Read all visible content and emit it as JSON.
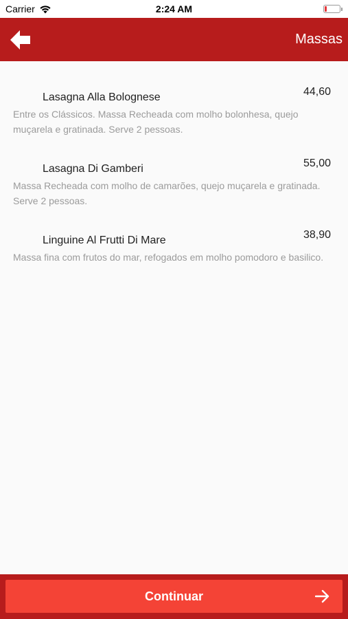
{
  "status_bar": {
    "carrier": "Carrier",
    "time": "2:24 AM",
    "battery_level": 0.15,
    "battery_color": "#e5383b"
  },
  "header": {
    "title": "Massas",
    "back_icon": "arrow-left-icon",
    "background": "#b71c1c"
  },
  "menu": {
    "items": [
      {
        "name": "Lasagna Alla Bolognese",
        "price": "44,60",
        "description": "Entre os Clássicos. Massa Recheada com molho bolonhesa, quejo muçarela e gratinada. Serve 2 pessoas."
      },
      {
        "name": "Lasagna Di Gamberi",
        "price": "55,00",
        "description": "Massa Recheada com molho de camarões, quejo muçarela e gratinada. Serve 2 pessoas."
      },
      {
        "name": "Linguine Al Frutti Di Mare",
        "price": "38,90",
        "description": "Massa fina com frutos do mar, refogados em molho pomodoro e basilico."
      }
    ]
  },
  "footer": {
    "continue_label": "Continuar",
    "arrow_icon": "arrow-right-icon",
    "button_color": "#f44336"
  }
}
